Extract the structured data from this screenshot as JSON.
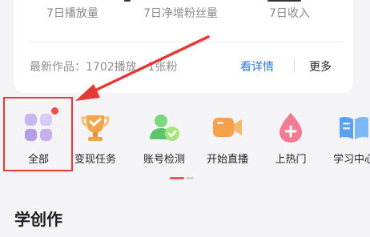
{
  "stats": {
    "items": [
      {
        "label": "7日播放量"
      },
      {
        "label": "7日净增粉丝量"
      },
      {
        "label": "7日收入"
      }
    ]
  },
  "latest_work": {
    "text": "最新作品：1702播放，1张粉",
    "detail_label": "看详情",
    "more_label": "更多"
  },
  "tools": [
    {
      "label": "全部",
      "icon": "grid-apps-icon",
      "badge": true
    },
    {
      "label": "变现任务",
      "icon": "trophy-icon"
    },
    {
      "label": "账号检测",
      "icon": "account-check-icon"
    },
    {
      "label": "开始直播",
      "icon": "video-camera-icon"
    },
    {
      "label": "上热门",
      "icon": "flame-drop-icon"
    },
    {
      "label": "学习中心",
      "icon": "book-icon"
    }
  ],
  "section": {
    "title": "学创作"
  },
  "colors": {
    "accent_red": "#e53935",
    "link_blue": "#2d77d8",
    "badge_red": "#f04d4d"
  }
}
